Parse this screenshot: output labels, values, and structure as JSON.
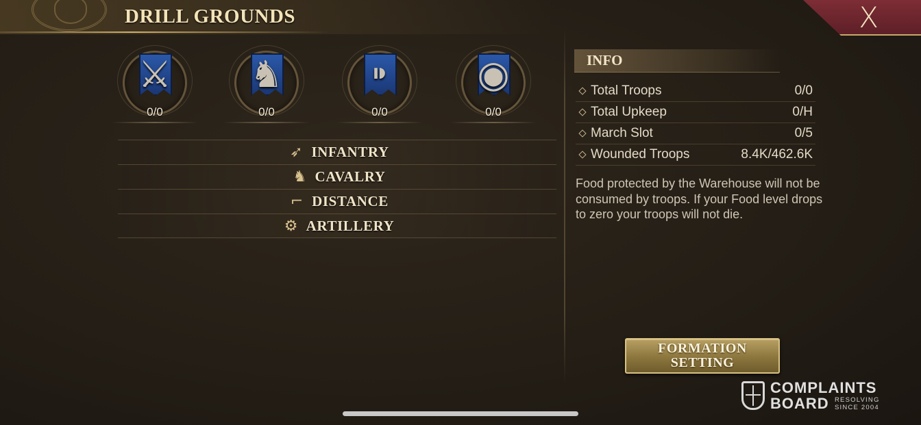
{
  "header": {
    "title": "DRILL GROUNDS",
    "close_label": "X"
  },
  "troops": [
    {
      "type": "infantry",
      "icon": "spear-banner-icon",
      "glyph": "⚔",
      "count": "0/0"
    },
    {
      "type": "cavalry",
      "icon": "horse-shield-banner-icon",
      "glyph": "♞",
      "count": "0/0"
    },
    {
      "type": "distance",
      "icon": "musket-banner-icon",
      "glyph": "⁍",
      "count": "0/0"
    },
    {
      "type": "artillery",
      "icon": "cannon-banner-icon",
      "glyph": "◉",
      "count": "0/0"
    }
  ],
  "categories": [
    {
      "label": "INFANTRY",
      "icon": "spear-icon",
      "glyph": "➶"
    },
    {
      "label": "CAVALRY",
      "icon": "horse-head-icon",
      "glyph": "♞"
    },
    {
      "label": "DISTANCE",
      "icon": "pistol-icon",
      "glyph": "⌐"
    },
    {
      "label": "ARTILLERY",
      "icon": "cannon-icon",
      "glyph": "⚙"
    }
  ],
  "info": {
    "title": "INFO",
    "rows": [
      {
        "label": "Total Troops",
        "value": "0/0"
      },
      {
        "label": "Total Upkeep",
        "value": "0/H"
      },
      {
        "label": "March Slot",
        "value": "0/5"
      },
      {
        "label": "Wounded Troops",
        "value": "8.4K/462.6K"
      }
    ],
    "description": "Food protected by the Warehouse will not be consumed by troops. If your Food level drops to zero your troops will not die."
  },
  "formation_button": {
    "label": "FORMATION\nSETTING"
  },
  "watermark": {
    "line1": "COMPLAINTS",
    "line2": "BOARD",
    "tagline1": "RESOLVING",
    "tagline2": "SINCE 2004"
  }
}
